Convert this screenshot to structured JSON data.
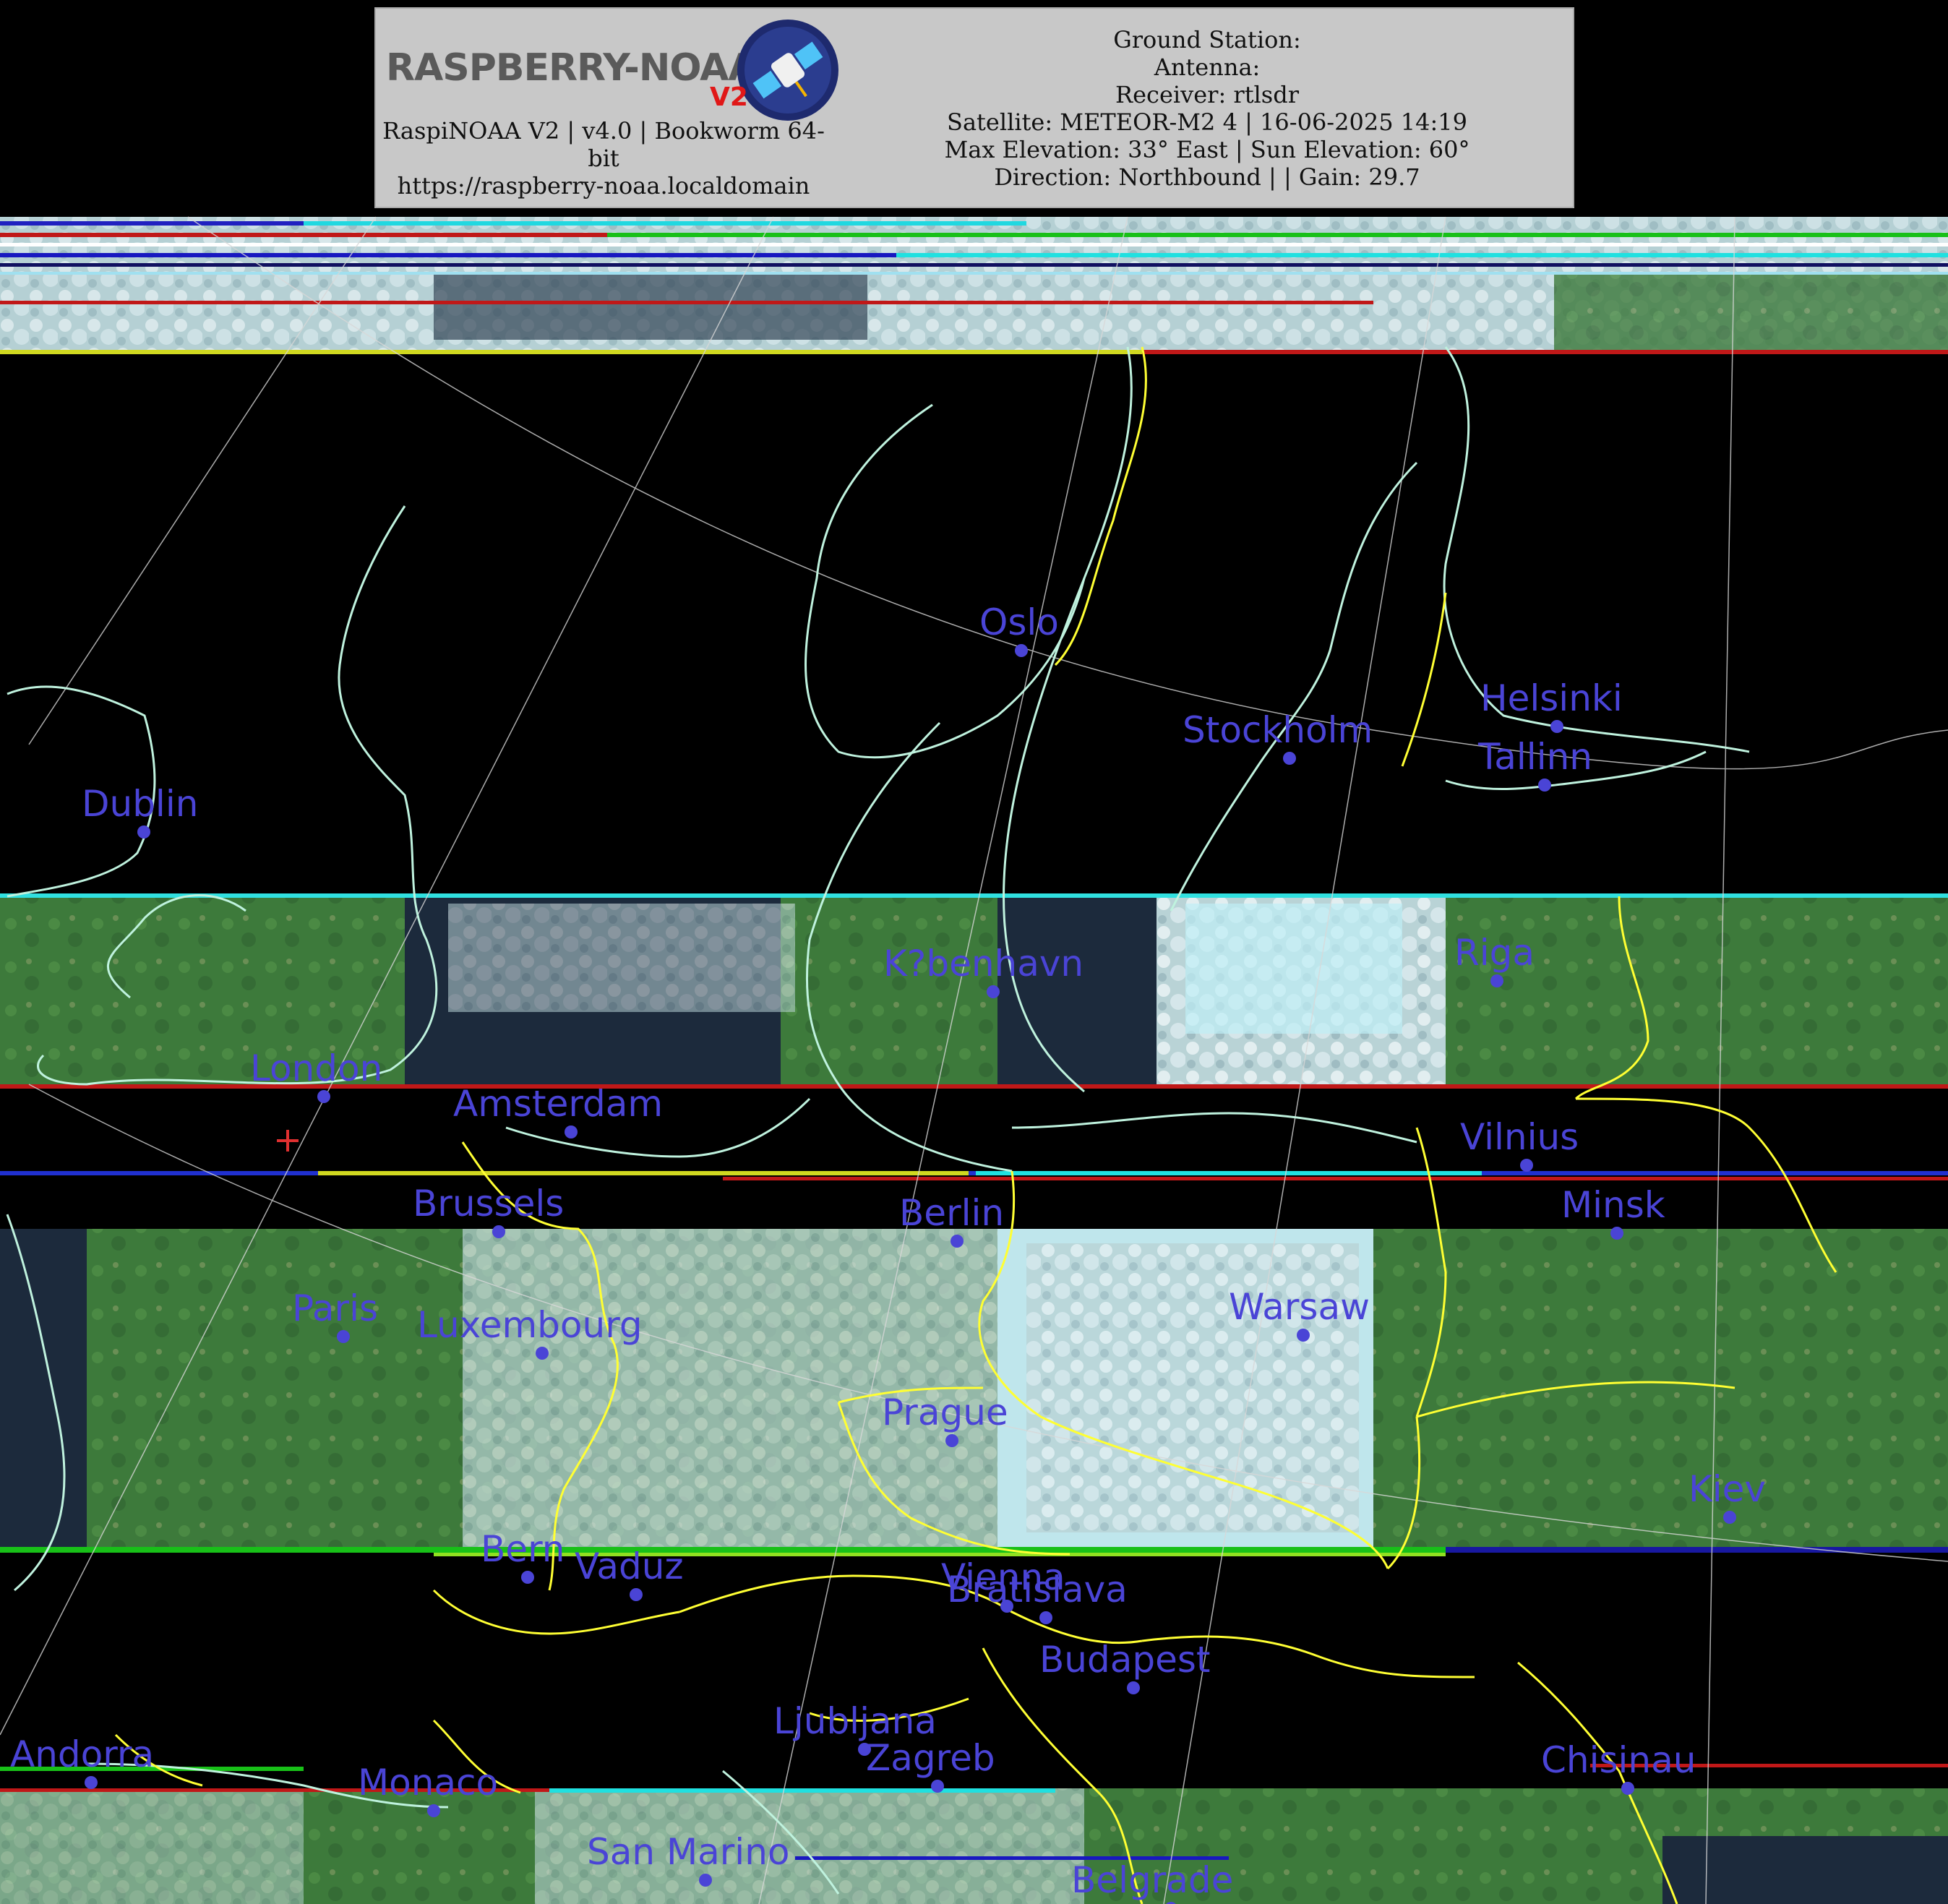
{
  "header": {
    "logo_text": "RASPBERRY-NOAA",
    "logo_badge": "V2",
    "software_line1": "RaspiNOAA V2 | v4.0 | Bookworm 64-",
    "software_line2": "bit",
    "url": "https://raspberry-noaa.localdomain",
    "ground_station": "Ground Station:",
    "antenna": "Antenna:",
    "receiver": "Receiver: rtlsdr",
    "satellite": "Satellite: METEOR-M2 4 | 16-06-2025 14:19",
    "elevation": "Max Elevation: 33° East | Sun Elevation: 60°",
    "direction": "Direction: Northbound | | Gain: 29.7"
  },
  "colors": {
    "header_bg": "#c8c8c8",
    "city_label": "#4a44d6",
    "coastline": "#bff2de",
    "border": "#ffff33",
    "ground_station_marker": "#e03030",
    "land": "#3f7a3c",
    "cloud": "#cfe3e8",
    "sea": "#1a2433"
  },
  "icons": {
    "logo": "satellite-icon",
    "station_marker": "plus-icon"
  },
  "cities": [
    {
      "name": "Oslo"
    },
    {
      "name": "Stockholm"
    },
    {
      "name": "Helsinki"
    },
    {
      "name": "Tallinn"
    },
    {
      "name": "Dublin"
    },
    {
      "name": "Riga"
    },
    {
      "name": "K?benhavn"
    },
    {
      "name": "London"
    },
    {
      "name": "Amsterdam"
    },
    {
      "name": "Vilnius"
    },
    {
      "name": "Brussels"
    },
    {
      "name": "Berlin"
    },
    {
      "name": "Minsk"
    },
    {
      "name": "Paris"
    },
    {
      "name": "Luxembourg"
    },
    {
      "name": "Warsaw"
    },
    {
      "name": "Prague"
    },
    {
      "name": "Kiev"
    },
    {
      "name": "Bern"
    },
    {
      "name": "Vaduz"
    },
    {
      "name": "Vienna"
    },
    {
      "name": "Bratislava"
    },
    {
      "name": "Budapest"
    },
    {
      "name": "Ljubljana"
    },
    {
      "name": "Zagreb"
    },
    {
      "name": "Andorra"
    },
    {
      "name": "Monaco"
    },
    {
      "name": "Chisinau"
    },
    {
      "name": "San Marino"
    },
    {
      "name": "Belgrade"
    }
  ]
}
